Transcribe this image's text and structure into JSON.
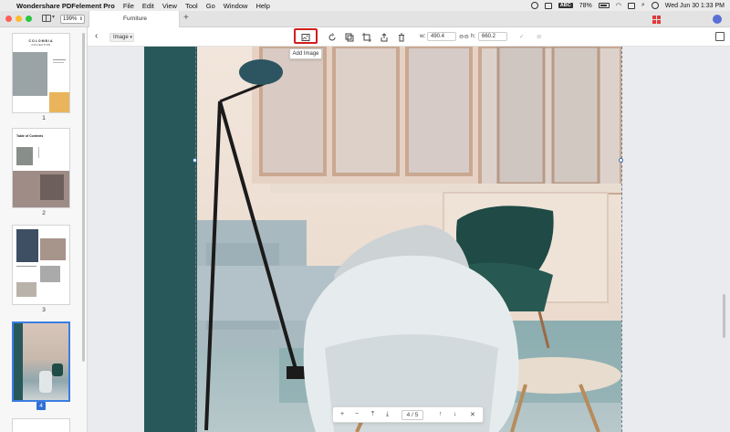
{
  "menubar": {
    "app_name": "Wondershare PDFelement Pro",
    "menus": [
      "File",
      "Edit",
      "View",
      "Tool",
      "Go",
      "Window",
      "Help"
    ],
    "input_source": "ABC",
    "battery": "78%",
    "datetime": "Wed Jun 30  1:33 PM"
  },
  "tabbar": {
    "zoom": "199%",
    "tab_title": "Furniture",
    "add_tab": "+"
  },
  "toolbar": {
    "mode": "Image",
    "width_label": "w:",
    "width_value": "490.4",
    "height_label": "h:",
    "height_value": "660.2",
    "tooltip": "Add Image"
  },
  "thumbnails": [
    {
      "number": "1"
    },
    {
      "number": "2"
    },
    {
      "number": "3"
    },
    {
      "number": "4",
      "selected": true
    }
  ],
  "thumb_texts": {
    "p1_brand": "COLOMBIA",
    "p1_sub": "COLLECTION",
    "p2_title": "Table of Contents"
  },
  "pager": {
    "current": "4",
    "separator": "/",
    "total": "5"
  },
  "colors": {
    "accent_red": "#d21e1e",
    "teal": "#29585a",
    "selection_blue": "#3b7de0"
  }
}
